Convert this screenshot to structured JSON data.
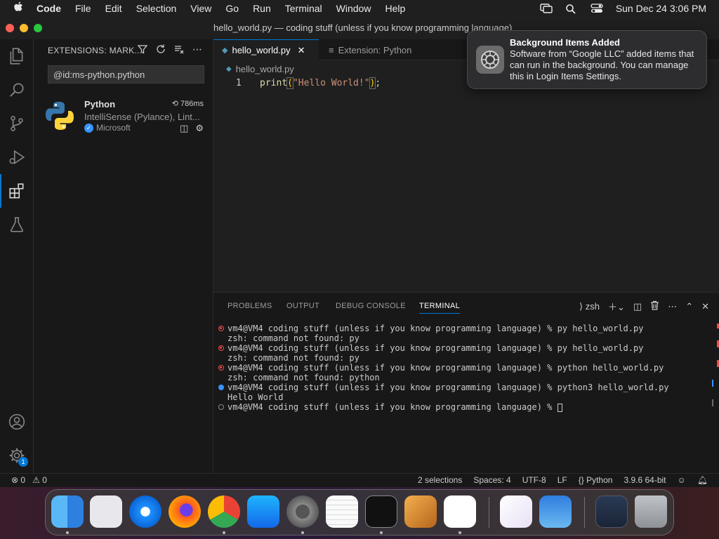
{
  "menubar": {
    "app": "Code",
    "items": [
      "File",
      "Edit",
      "Selection",
      "View",
      "Go",
      "Run",
      "Terminal",
      "Window",
      "Help"
    ],
    "clock": "Sun Dec 24  3:06 PM"
  },
  "window": {
    "title": "hello_world.py — coding stuff (unless if you know programming language)"
  },
  "sidebar": {
    "header": "EXTENSIONS: MARK...",
    "search_value": "@id:ms-python.python",
    "extension": {
      "name": "Python",
      "time": "786ms",
      "description": "IntelliSense (Pylance), Lint...",
      "publisher": "Microsoft"
    }
  },
  "tabs": [
    {
      "label": "hello_world.py",
      "active": true
    },
    {
      "label": "Extension: Python",
      "active": false
    }
  ],
  "editor": {
    "breadcrumb": "hello_world.py",
    "line_number": "1",
    "code": {
      "fn": "print",
      "open": "(",
      "string": "\"Hello World!\"",
      "close": ")",
      "semi": ";"
    }
  },
  "notification": {
    "title": "Background Items Added",
    "body": "Software from “Google LLC” added items that can run in the background. You can manage this in Login Items Settings."
  },
  "panel": {
    "tabs": [
      "PROBLEMS",
      "OUTPUT",
      "DEBUG CONSOLE",
      "TERMINAL"
    ],
    "shell": "zsh",
    "terminal_lines": [
      {
        "text": "vm4@VM4 coding stuff (unless if you know programming language) % py hello_world.py",
        "status": "err"
      },
      {
        "text": "zsh: command not found: py",
        "status": "none"
      },
      {
        "text": "vm4@VM4 coding stuff (unless if you know programming language) % py hello_world.py",
        "status": "err"
      },
      {
        "text": "zsh: command not found: py",
        "status": "none"
      },
      {
        "text": "vm4@VM4 coding stuff (unless if you know programming language) % python hello_world.py",
        "status": "err"
      },
      {
        "text": "zsh: command not found: python",
        "status": "none"
      },
      {
        "text": "vm4@VM4 coding stuff (unless if you know programming language) % python3 hello_world.py",
        "status": "ok"
      },
      {
        "text": "Hello World",
        "status": "none"
      },
      {
        "text": "vm4@VM4 coding stuff (unless if you know programming language) % ",
        "status": "idle"
      }
    ]
  },
  "statusbar": {
    "errors": "0",
    "warnings": "0",
    "selections": "2 selections",
    "spaces": "Spaces: 4",
    "encoding": "UTF-8",
    "eol": "LF",
    "language": "Python",
    "interpreter": "3.9.6 64-bit"
  },
  "activity": {
    "accounts_badge": "1"
  },
  "dock": {
    "apps": [
      "finder-icon",
      "launchpad-icon",
      "safari-icon",
      "firefox-icon",
      "chrome-icon",
      "app-store-icon",
      "system-settings-icon",
      "textedit-icon",
      "terminal-icon",
      "garageband-icon",
      "vscode-icon",
      "visual-studio-icon",
      "weather-icon",
      "chrome-window-icon",
      "trash-icon"
    ]
  },
  "colors": {
    "accent": "#0078d4",
    "error": "#f14c4c",
    "info": "#3794ff",
    "string": "#ce9178",
    "function": "#dcdcaa"
  }
}
